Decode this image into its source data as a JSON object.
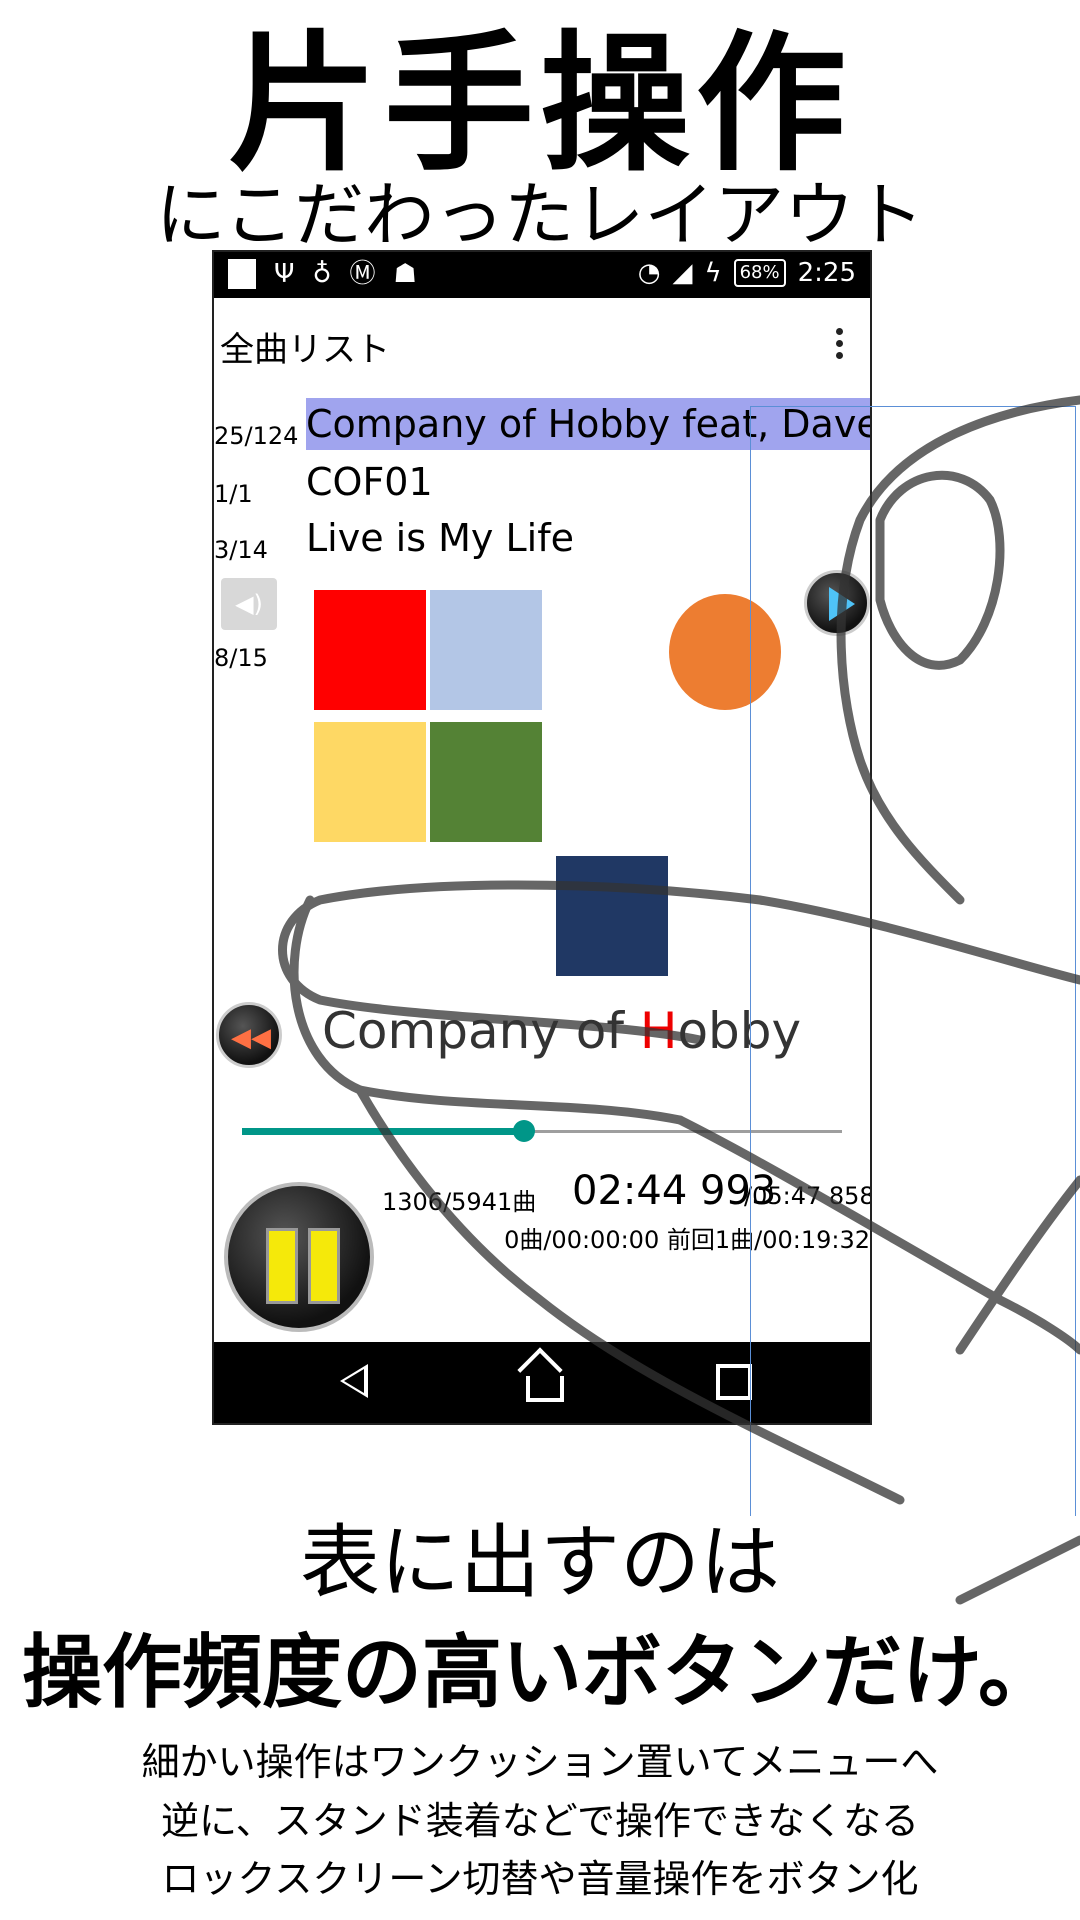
{
  "headline": {
    "title": "片手操作",
    "subtitle": "にこだわったレイアウト",
    "lead_line1": "表に出すのは",
    "lead_line2": "操作頻度の高いボタンだけ。",
    "description": [
      "細かい操作はワンクッション置いてメニューへ",
      "逆に、スタンド装着などで操作できなくなる",
      "ロックスクリーン切替や音量操作をボタン化"
    ]
  },
  "status_bar": {
    "battery": "68%",
    "time": "2:25"
  },
  "app_bar": {
    "title": "全曲リスト",
    "menu_icon": "more-vert-icon"
  },
  "player": {
    "counters": [
      "25/124",
      "1/1",
      "3/14",
      "8/15"
    ],
    "track_title": "Company of Hobby feat, Dave M",
    "album": "COF01",
    "song": "Live is My Life",
    "brand_text_prefix": "Company of ",
    "brand_text_highlight": "H",
    "brand_text_suffix": "obby",
    "progress": 0.47,
    "count_text": "1306/5941曲",
    "time_current": "02:44 993",
    "time_total": "/05:47 858",
    "history_text": "0曲/00:00:00  前回1曲/00:19:32"
  },
  "colors": {
    "tile_red": "#ff0000",
    "tile_lightblue": "#b3c6e6",
    "tile_yellow": "#fed864",
    "tile_green": "#548235",
    "tile_navy": "#203864",
    "circle_orange": "#ed7d31",
    "highlight": "#a0a4ee",
    "accent": "#009688"
  }
}
